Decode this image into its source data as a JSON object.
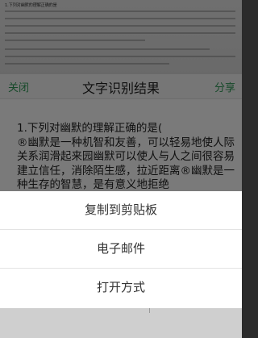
{
  "toolbar": {
    "close_label": "关闭",
    "title": "文字识别结果",
    "share_label": "分享"
  },
  "ocr": {
    "text": "1.下列对幽默的理解正确的是(\n®幽默是一种机智和友善，可以轻易地使人际关系润滑起来园幽默可以使人与人之间很容易\n建立信任，消除陌生感，拉近距离®幽默是一种生存的智慧，是有意义地拒绝"
  },
  "menu": {
    "copy_label": "复制到剪贴板",
    "email_label": "电子邮件",
    "open_with_label": "打开方式"
  }
}
